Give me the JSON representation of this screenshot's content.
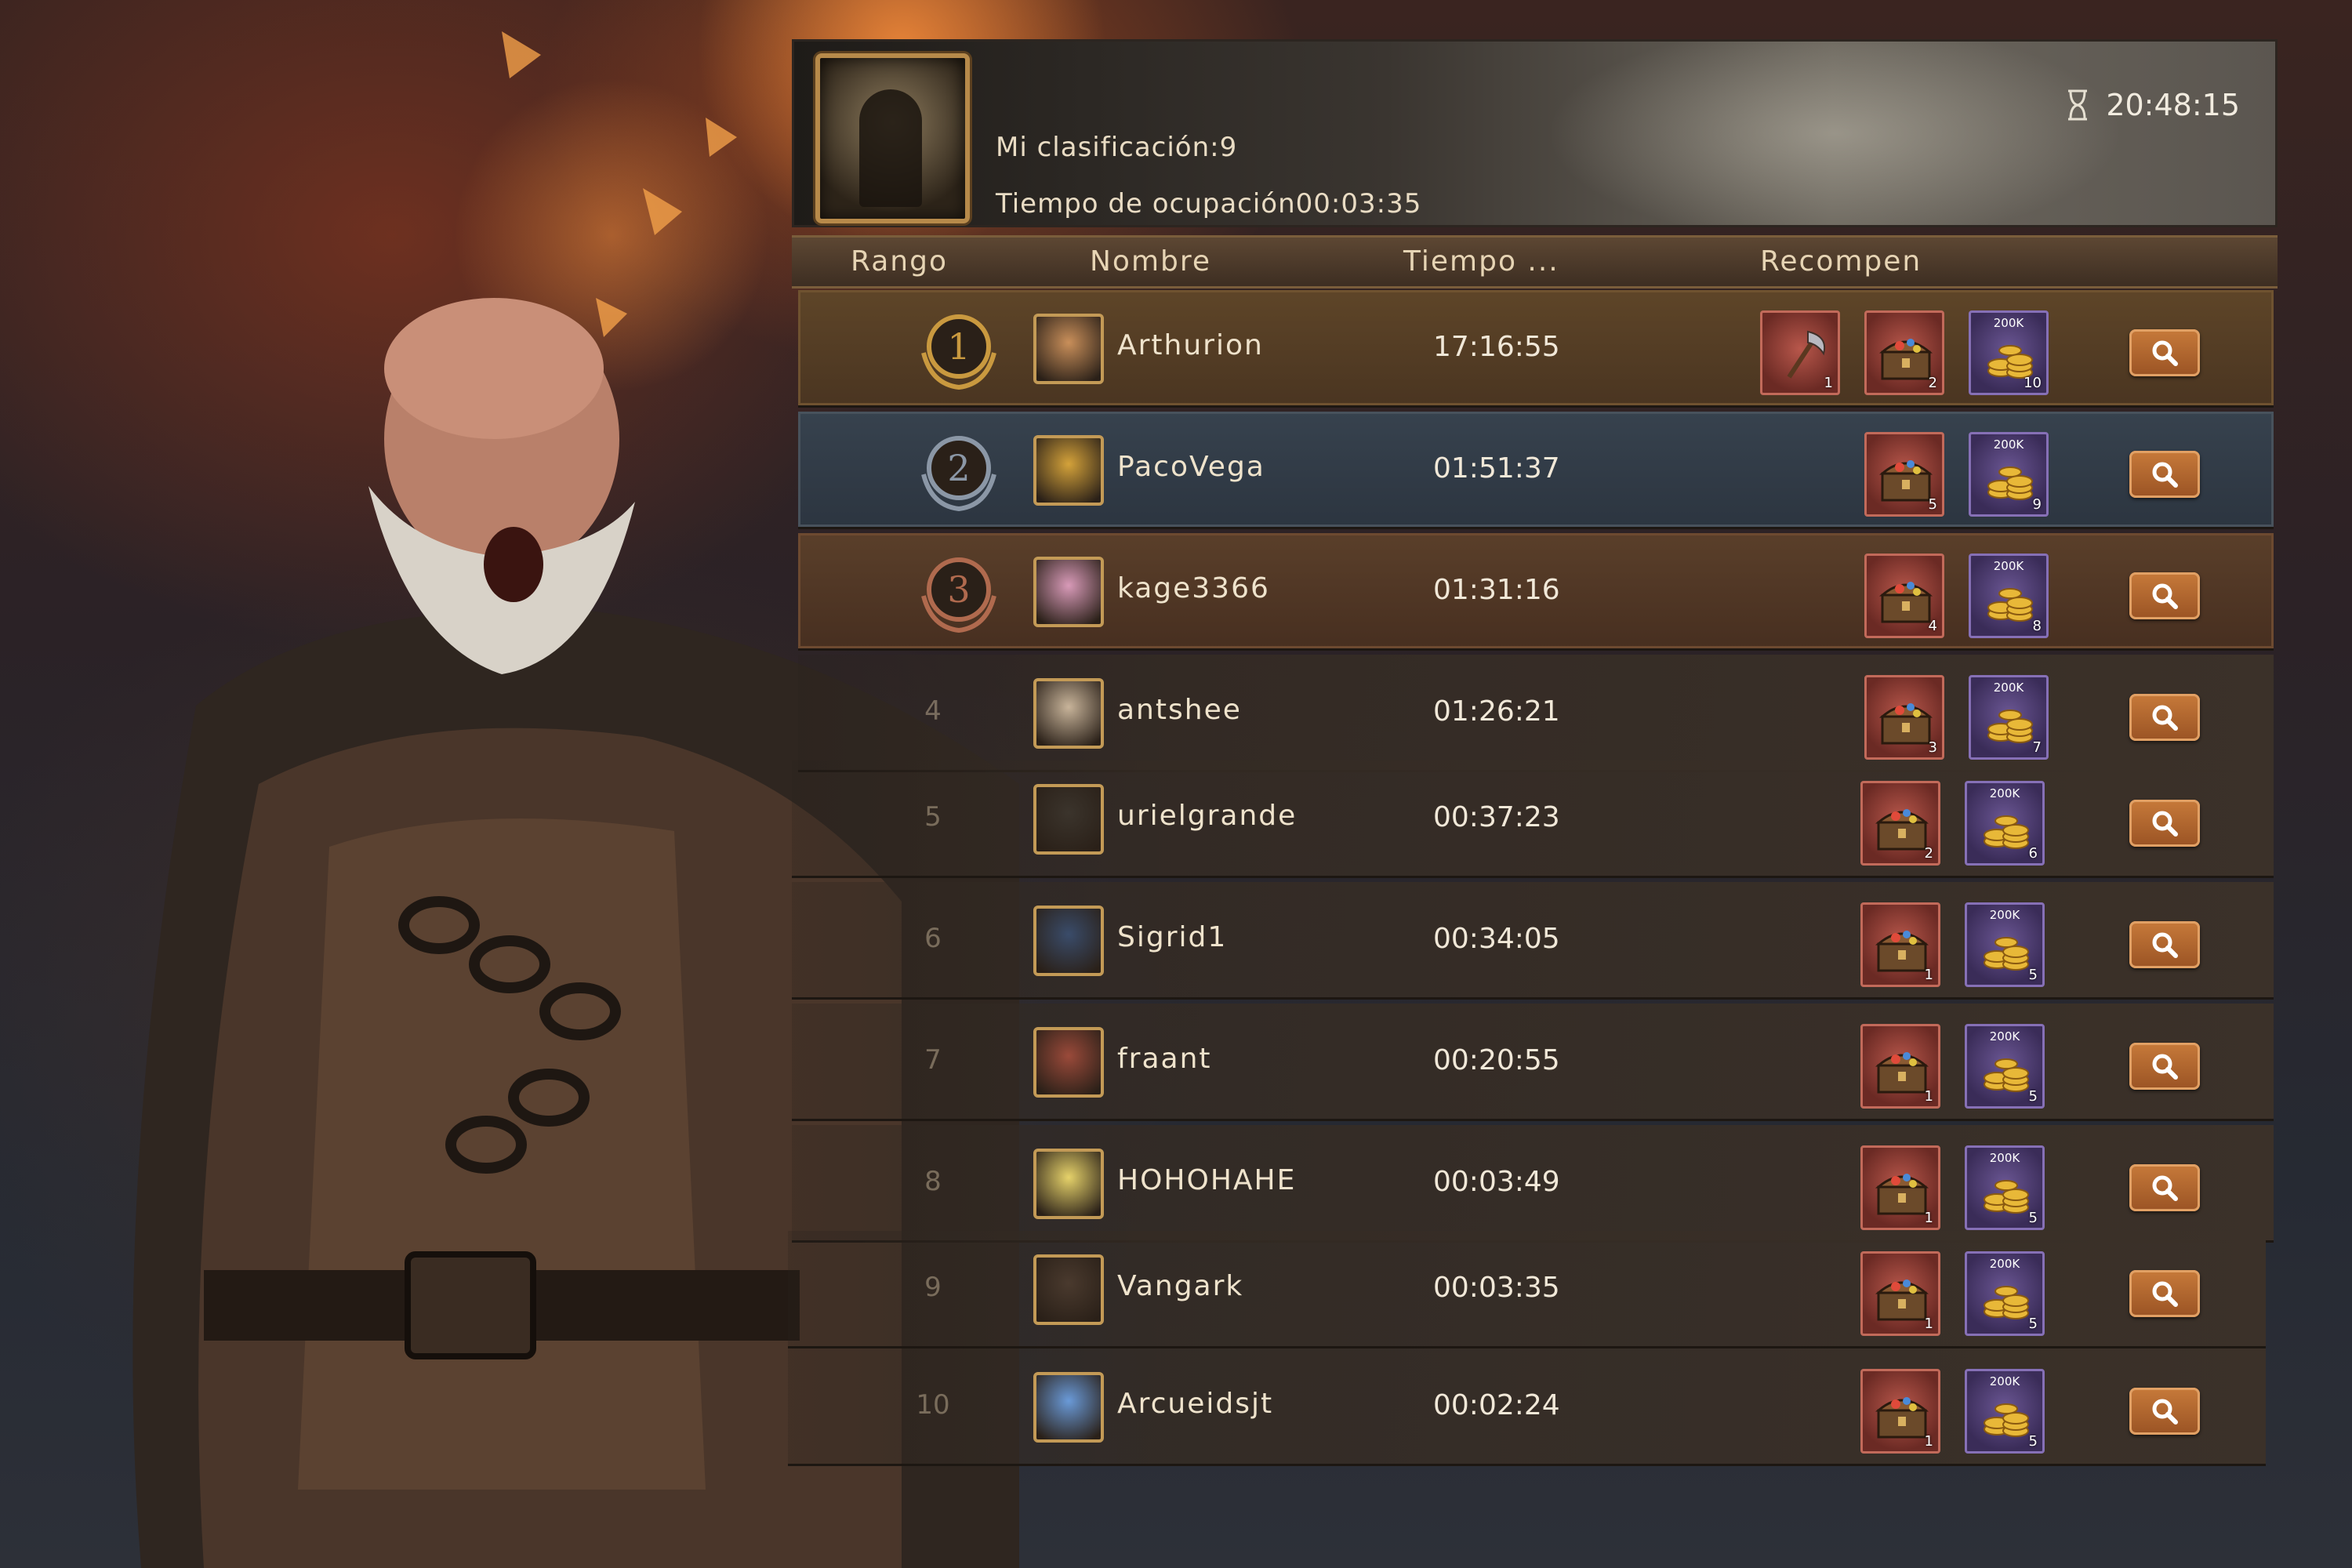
{
  "header": {
    "my_rank_label": "Mi clasificación:",
    "my_rank_value": "9",
    "occupation_label": "Tiempo de ocupación",
    "occupation_value": "00:03:35",
    "timer": "20:48:15"
  },
  "columns": {
    "rank": "Rango",
    "name": "Nombre",
    "time": "Tiempo ...",
    "rewards": "Recompen"
  },
  "reward_labels": {
    "gold_tag": "200K"
  },
  "rows": [
    {
      "rank": "1",
      "name": "Arthurion",
      "time": "17:16:55",
      "rewards": [
        "1",
        "2",
        "10"
      ]
    },
    {
      "rank": "2",
      "name": "PacoVega",
      "time": "01:51:37",
      "rewards": [
        "5",
        "9"
      ]
    },
    {
      "rank": "3",
      "name": "kage3366",
      "time": "01:31:16",
      "rewards": [
        "4",
        "8"
      ]
    },
    {
      "rank": "4",
      "name": "antshee",
      "time": "01:26:21",
      "rewards": [
        "3",
        "7"
      ]
    },
    {
      "rank": "5",
      "name": "urielgrande",
      "time": "00:37:23",
      "rewards": [
        "2",
        "6"
      ]
    },
    {
      "rank": "6",
      "name": "Sigrid1",
      "time": "00:34:05",
      "rewards": [
        "1",
        "5"
      ]
    },
    {
      "rank": "7",
      "name": "fraant",
      "time": "00:20:55",
      "rewards": [
        "1",
        "5"
      ]
    },
    {
      "rank": "8",
      "name": "HOHOHAHE",
      "time": "00:03:49",
      "rewards": [
        "1",
        "5"
      ]
    },
    {
      "rank": "9",
      "name": "Vangark",
      "time": "00:03:35",
      "rewards": [
        "1",
        "5"
      ]
    },
    {
      "rank": "10",
      "name": "Arcueidsjt",
      "time": "00:02:24",
      "rewards": [
        "1",
        "5"
      ]
    }
  ]
}
